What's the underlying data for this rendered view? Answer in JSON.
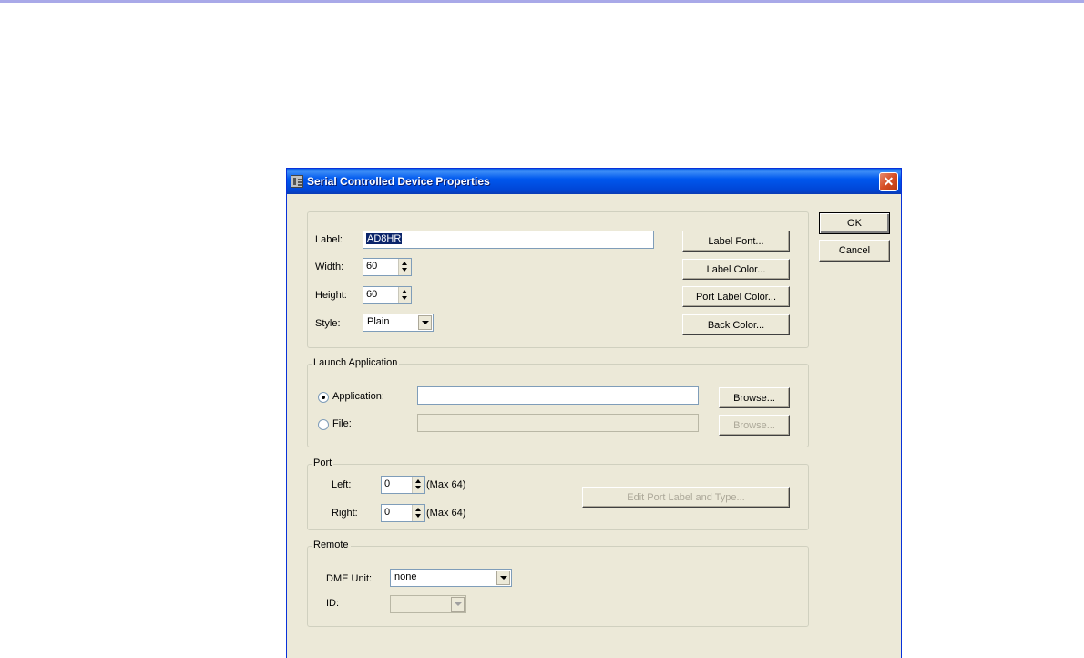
{
  "window": {
    "title": "Serial Controlled Device Properties",
    "close_glyph": "✕"
  },
  "buttons": {
    "ok": "OK",
    "cancel": "Cancel"
  },
  "props": {
    "label_label": "Label:",
    "label_value": "AD8HR",
    "width_label": "Width:",
    "width_value": "60",
    "height_label": "Height:",
    "height_value": "60",
    "style_label": "Style:",
    "style_value": "Plain",
    "label_font": "Label Font...",
    "label_color": "Label Color...",
    "port_label_color": "Port Label Color...",
    "back_color": "Back Color..."
  },
  "launch": {
    "legend": "Launch Application",
    "application_label": "Application:",
    "application_value": "",
    "file_label": "File:",
    "file_value": "",
    "browse": "Browse...",
    "selected": "application"
  },
  "port": {
    "legend": "Port",
    "left_label": "Left:",
    "left_value": "0",
    "right_label": "Right:",
    "right_value": "0",
    "max_text": "(Max 64)",
    "edit_button": "Edit Port Label and Type..."
  },
  "remote": {
    "legend": "Remote",
    "dme_label": "DME Unit:",
    "dme_value": "none",
    "id_label": "ID:",
    "id_value": ""
  }
}
